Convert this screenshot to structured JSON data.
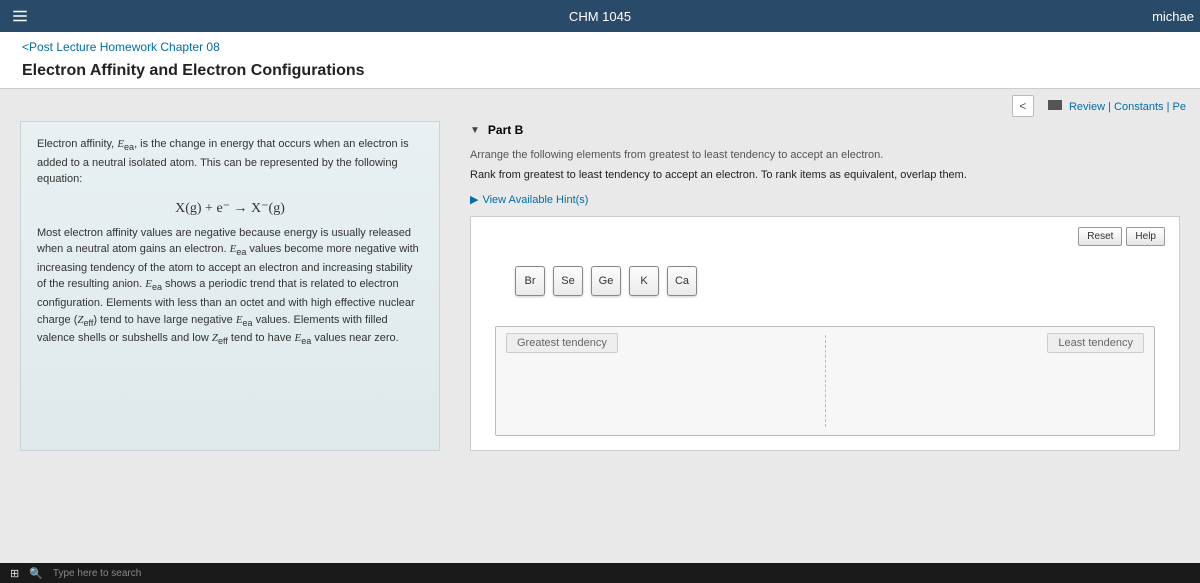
{
  "topbar": {
    "course": "CHM 1045",
    "user": "michae"
  },
  "subheader": {
    "breadcrumb": "<Post Lecture Homework Chapter 08",
    "title": "Electron Affinity and Electron Configurations"
  },
  "actions": {
    "review": "Review",
    "constants": "Constants",
    "pt": "Pe"
  },
  "left": {
    "p1a": "Electron affinity, ",
    "p1b": ", is the change in energy that occurs when an electron is added to a neutral isolated atom. This can be represented by the following equation:",
    "eq": "X(g) + e⁻ → X⁻(g)",
    "p2a": "Most electron affinity values are negative because energy is usually released when a neutral atom gains an electron.  ",
    "p2b": " values become more negative with increasing tendency of the atom to accept an electron and increasing stability of the resulting anion. ",
    "p2c": " shows a periodic trend that is related to electron configuration. Elements with less than an octet and with high effective nuclear charge (",
    "p2d": ") tend to have large negative ",
    "p2e": " values. Elements with filled valence shells or subshells and low ",
    "p2f": " tend to have ",
    "p2g": " values near zero."
  },
  "right": {
    "part": "Part B",
    "instr1": "Arrange the following elements from greatest to least tendency to accept an electron.",
    "instr2": "Rank from greatest to least tendency to accept an electron.  To rank items as equivalent, overlap them.",
    "hints": "View Available Hint(s)",
    "reset": "Reset",
    "help": "Help",
    "tiles": [
      "Br",
      "Se",
      "Ge",
      "K",
      "Ca"
    ],
    "dz_left": "Greatest tendency",
    "dz_right": "Least tendency"
  },
  "taskbar": {
    "search": "Type here to search"
  }
}
